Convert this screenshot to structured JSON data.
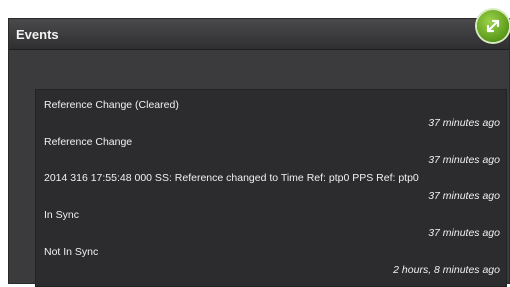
{
  "panel": {
    "title": "Events",
    "expand_icon": "expand-arrows-icon",
    "colors": {
      "header_bg": "#3a3a3c",
      "body_bg": "#2c2c2e",
      "text": "#f0f0f0",
      "button_green": "#6aaa28"
    }
  },
  "events": [
    {
      "message": "Reference Change (Cleared)",
      "time": "37 minutes ago"
    },
    {
      "message": "Reference Change",
      "time": "37 minutes ago"
    },
    {
      "message": "2014 316 17:55:48 000 SS: Reference changed to Time Ref: ptp0 PPS Ref: ptp0",
      "time": "37 minutes ago"
    },
    {
      "message": "In Sync",
      "time": "37 minutes ago"
    },
    {
      "message": "Not In Sync",
      "time": "2 hours, 8 minutes ago"
    }
  ]
}
